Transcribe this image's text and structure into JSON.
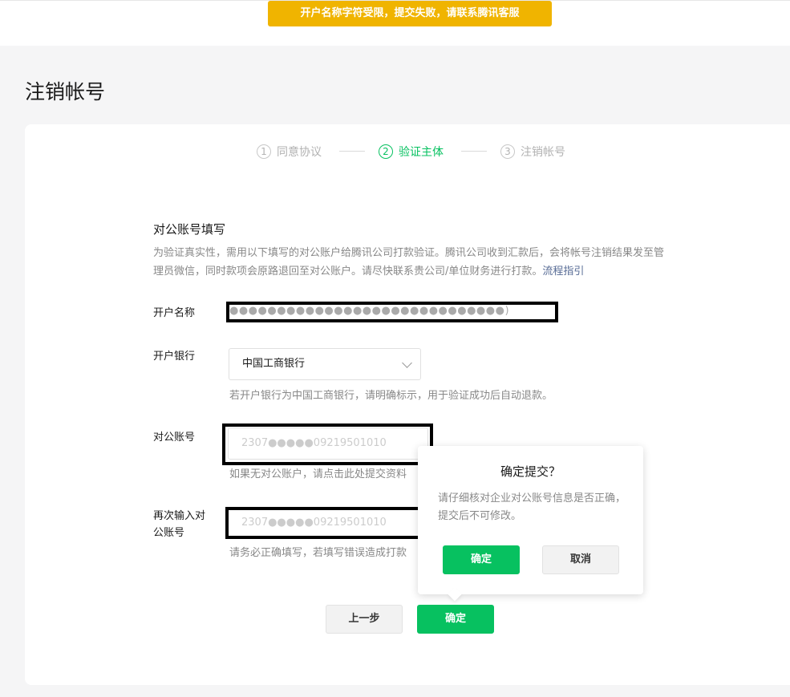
{
  "toast": {
    "message": "开户名称字符受限，提交失败，请联系腾讯客服"
  },
  "page": {
    "title": "注销帐号"
  },
  "steps": [
    {
      "num": "1",
      "label": "同意协议"
    },
    {
      "num": "2",
      "label": "验证主体"
    },
    {
      "num": "3",
      "label": "注销帐号"
    }
  ],
  "section": {
    "title": "对公账号填写",
    "description": "为验证真实性，需用以下填写的对公账户给腾讯公司打款验证。腾讯公司收到汇款后，会将帐号注销结果发至管理员微信，同时款项会原路退回至对公账户。请尽快联系贵公司/单位财务进行打款。",
    "guide_link": "流程指引"
  },
  "form": {
    "account_name": {
      "label": "开户名称",
      "value": "●●●●●●●●●●●●●●●●●●●●●●●●●●●●●)"
    },
    "bank": {
      "label": "开户银行",
      "value": "中国工商银行",
      "hint": "若开户银行为中国工商银行，请明确标示，用于验证成功后自动退款。"
    },
    "account_number": {
      "label": "对公账号",
      "value": "2307●●●●●09219501010",
      "hint": "如果无对公账户，请点击此处提交资料"
    },
    "confirm_account": {
      "label_line1": "再次输入对",
      "label_line2": "公账号",
      "value": "2307●●●●●09219501010",
      "hint": "请务必正确填写，若填写错误造成打款"
    }
  },
  "buttons": {
    "prev": "上一步",
    "confirm": "确定"
  },
  "popover": {
    "title": "确定提交？",
    "message": "请仔细核对企业对公账号信息是否正确，提交后不可修改。",
    "ok": "确定",
    "cancel": "取消"
  }
}
